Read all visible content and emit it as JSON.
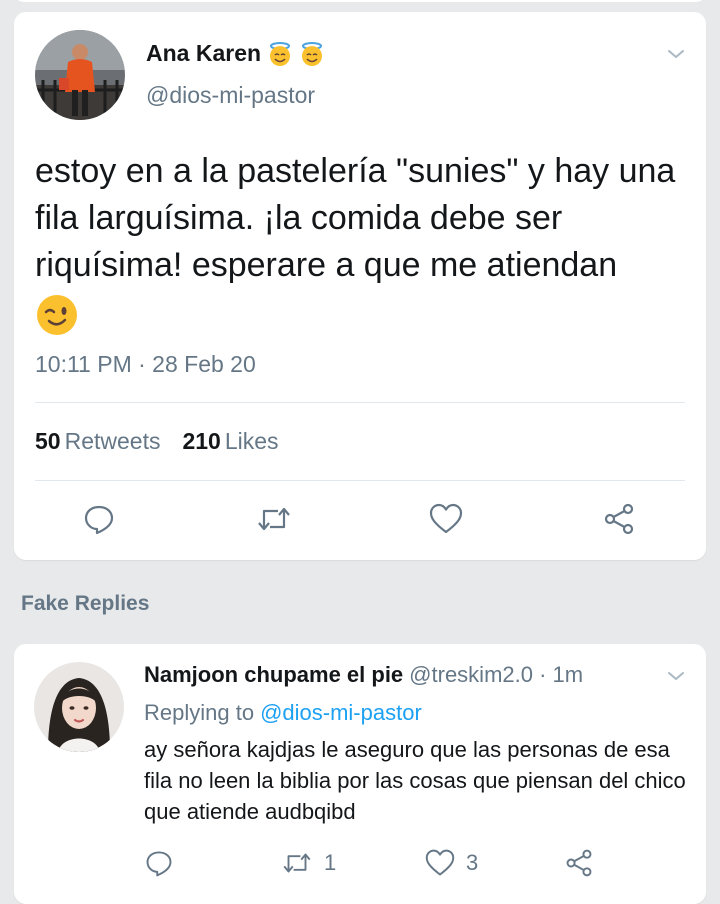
{
  "main_tweet": {
    "display_name": "Ana Karen",
    "name_emojis": [
      "angel-face-emoji",
      "angel-face-emoji"
    ],
    "handle": "@dios-mi-pastor",
    "text": "estoy en a la pastelería \"sunies\" y hay una fila larguísima. ¡la comida debe ser riquísima! esperare a que me atiendan",
    "text_emoji": "winking-face-emoji",
    "timestamp": "10:11 PM · 28 Feb 20",
    "retweets_count": "50",
    "retweets_label": "Retweets",
    "likes_count": "210",
    "likes_label": "Likes",
    "actions": [
      "reply-icon",
      "retweet-icon",
      "like-icon",
      "share-icon"
    ]
  },
  "section": {
    "label": "Fake Replies"
  },
  "reply": {
    "display_name": "Namjoon chupame el pie",
    "handle_time": "@treskim2.0 · 1m",
    "replying_prefix": "Replying to",
    "replying_handle": "@dios-mi-pastor",
    "text": "ay señora kajdjas le aseguro que las personas de esa fila no leen la biblia por las cosas que piensan del chico que atiende audbqibd",
    "retweet_count": "1",
    "like_count": "3"
  },
  "colors": {
    "background": "#e8e9ea",
    "card": "#ffffff",
    "text": "#14171a",
    "secondary": "#657786",
    "link": "#1da1f2"
  }
}
